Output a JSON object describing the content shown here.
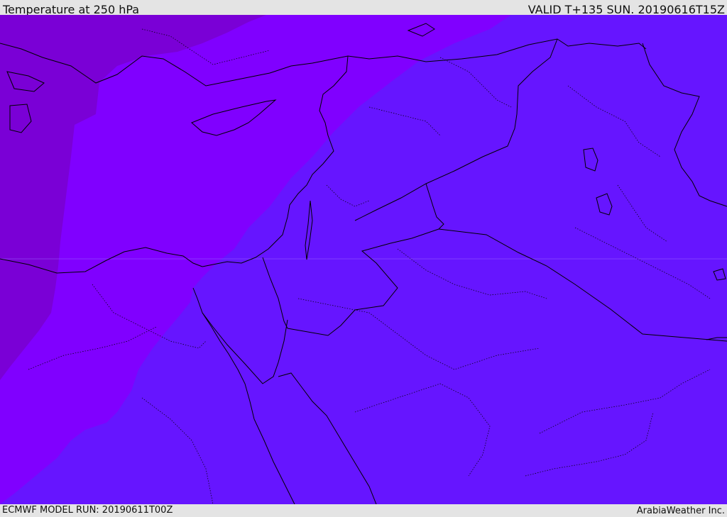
{
  "header": {
    "title": "Temperature at 250 hPa",
    "valid_time": "VALID T+135 SUN. 20190616T15Z"
  },
  "footer": {
    "model_run": "ECMWF MODEL RUN: 20190611T00Z",
    "credit": "ArabiaWeather Inc."
  },
  "map": {
    "fill_colors": {
      "coldest": "#7a00d6",
      "cold": "#8000ff",
      "mild": "#6615ff"
    },
    "line_color": "#000000"
  }
}
